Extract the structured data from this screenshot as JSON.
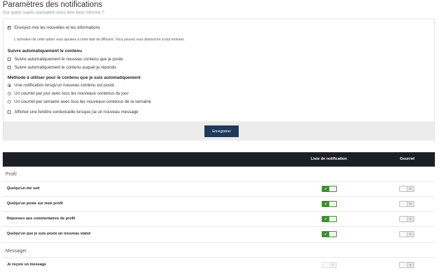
{
  "header": {
    "title": "Paramètres des notifications",
    "subtitle": "Sur quels sujets souhaitez-vous être tenu informé ?"
  },
  "panel": {
    "newsletter": {
      "label": "Envoyez-moi les nouvelles et les informations",
      "checked": true
    },
    "newsletter_help": "L'activation de cette option vous ajoutera à notre liste de diffusion. Vous pouvez vous désinscrire à tout moment.",
    "follow_section": "Suivre automatiquement le contenu",
    "follow_options": [
      {
        "label": "Suivre automatiquement le nouveau contenu que je poste",
        "checked": false
      },
      {
        "label": "Suivre automatiquement le contenu auquel je réponds",
        "checked": false
      }
    ],
    "method_section": "Méthode à utiliser pour le contenu que je suis automatiquement",
    "method_options": [
      {
        "label": "Une notification lorsqu'un nouveau contenu est posté",
        "selected": true
      },
      {
        "label": "Un courriel par jour avec tous les nouveaux contenus du jour",
        "selected": false
      },
      {
        "label": "Un courriel par semaine avec tous les nouveaux contenus de la semaine",
        "selected": false
      }
    ],
    "popup": {
      "label": "Afficher une fenêtre contextuelle lorsque j'ai un nouveau message",
      "checked": false
    },
    "save_label": "Enregistrer"
  },
  "table": {
    "col_list": "Liste de notification",
    "col_email": "Courriel",
    "groups": [
      {
        "name": "Profil",
        "rows": [
          {
            "label": "Quelqu'un me suit",
            "list": "on",
            "email": "off"
          },
          {
            "label": "Quelqu'un poste sur mon profil",
            "list": "on",
            "email": "off"
          },
          {
            "label": "Réponses aux commentaires de profil",
            "list": "on",
            "email": "off"
          },
          {
            "label": "Quelqu'un que je suis poste un nouveau statut",
            "list": "on",
            "email": "off"
          }
        ]
      },
      {
        "name": "Messager",
        "rows": [
          {
            "label": "Je reçois un message",
            "list": "disabled",
            "email": "off"
          }
        ]
      }
    ]
  },
  "colors": {
    "toggle_on": "#3e8e2f",
    "save_button": "#1e3a5a",
    "table_header": "#1c1f24"
  }
}
